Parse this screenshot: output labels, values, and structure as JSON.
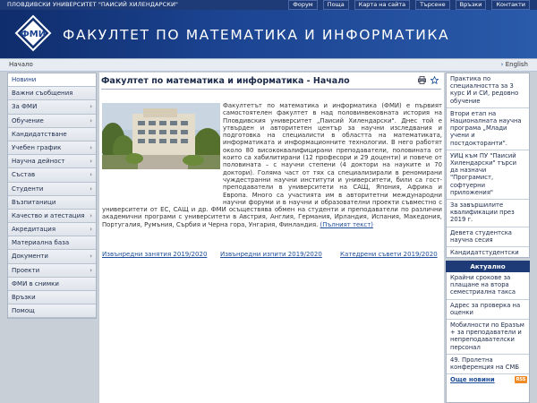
{
  "topbar": {
    "university": "ПЛОВДИВСКИ УНИВЕРСИТЕТ \"ПАИСИЙ ХИЛЕНДАРСКИ\"",
    "links": [
      "Форум",
      "Поща",
      "Карта на сайта",
      "Търсене",
      "Връзки",
      "Контакти"
    ]
  },
  "header": {
    "title": "ФАКУЛТЕТ ПО МАТЕМАТИКА И ИНФОРМАТИКА",
    "logo_icon": "fmi-logo-icon"
  },
  "breadcrumb": {
    "home": "Начало",
    "language": "English"
  },
  "sidebar": {
    "items": [
      {
        "label": "Новини",
        "arrow": ""
      },
      {
        "label": "Важни съобщения",
        "arrow": ""
      },
      {
        "label": "За ФМИ",
        "arrow": "›"
      },
      {
        "label": "Обучение",
        "arrow": "›"
      },
      {
        "label": "Кандидатстване",
        "arrow": ""
      },
      {
        "label": "Учебен график",
        "arrow": "›"
      },
      {
        "label": "Научна дейност",
        "arrow": "›"
      },
      {
        "label": "Състав",
        "arrow": "›"
      },
      {
        "label": "Студенти",
        "arrow": "›"
      },
      {
        "label": "Възпитаници",
        "arrow": ""
      },
      {
        "label": "Качество и атестация",
        "arrow": "›"
      },
      {
        "label": "Акредитация",
        "arrow": "›"
      },
      {
        "label": "Материална база",
        "arrow": ""
      },
      {
        "label": "Документи",
        "arrow": "›"
      },
      {
        "label": "Проекти",
        "arrow": "›"
      },
      {
        "label": "ФМИ в снимки",
        "arrow": ""
      },
      {
        "label": "Връзки",
        "arrow": ""
      },
      {
        "label": "Помощ",
        "arrow": ""
      }
    ]
  },
  "main": {
    "title": "Факултет по математика и информатика - Начало",
    "body": "Факултетът по математика и информатика (ФМИ) е първият самостоятелен факултет в над половинвековната история на Пловдивския университет „Паисий Хилендарски\". Днес той е утвърден и авторитетен център за научни изследвания и подготовка на специалисти в областта на математиката, информатиката и информационните технологии. В него работят около 80 висококвалифицирани преподаватели, половината от които са хабилитирани (12 професори и 29 доценти) и повече от половината – с научни степени (4 доктори на науките и 70 доктори). Голяма част от тях са специализирали в реномирани чуждестранни научни институти и университети, били са гост-преподаватели в университети на САЩ, Япония, Африка и Европа. Много са участията им в авторитетни международни научни форуми и в научни и образователни проекти съвместно с университети от ЕС, САЩ и др. ФМИ осъществява обмен на студенти и преподаватели по различни академични програми с университети в Австрия, Англия, Германия, Ирландия, Испания, Македония, Португалия, Румъния, Сърбия и Черна гора, Унгария, Финландия.",
    "full_text_link": "(Пълният текст)",
    "bottom_links": [
      "Извънредни занятия 2019/2020",
      "Извънредни изпити 2019/2020",
      "Катедрени съвети 2019/2020"
    ]
  },
  "right": {
    "news_top": [
      "Практика по специалността за 3 курс И и СИ, редовно обучение",
      "Втори етап на Националната научна програма „Млади учени и постдокторанти\".",
      "УИЦ към ПУ \"Паисий Хилендарски\" търси да назначи \"Програмист, софтуерни приложения\"",
      "За завършилите квалификации през 2019 г.",
      "Девета студентска научна сесия",
      "Кандидатстудентски курс по информатика и програмиране на C#"
    ],
    "aktualno": "Актуално",
    "news_bottom": [
      "Крайни срокове за плащане на втора семестриална такса",
      "Адрес за проверка на оценки",
      "Мобилности по Еразъм + за преподаватели и непреподавателски персонал",
      "49. Пролетна конференция на СМБ"
    ],
    "more": "Още новини",
    "rss": "RSS"
  },
  "colors": {
    "topbar": "#1e3b78",
    "banner": "#1b4390",
    "link": "#1d4d9a"
  }
}
